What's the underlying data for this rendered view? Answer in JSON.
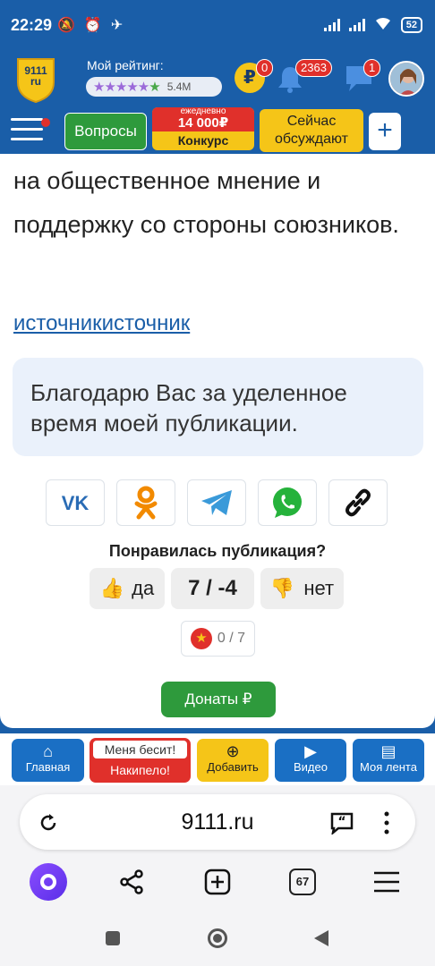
{
  "status_bar": {
    "time": "22:29",
    "battery": "52",
    "left_icons": [
      "muted-bell-icon",
      "alarm-icon",
      "telegram-icon"
    ],
    "right_icons": [
      "signal-icon",
      "signal-icon",
      "wifi-icon",
      "battery-icon"
    ]
  },
  "header": {
    "logo_text_top": "9111",
    "logo_text_bottom": "ru",
    "rating_label": "Мой рейтинг:",
    "stars": "★★★★★",
    "star_last": "★",
    "rating_count": "5.4M",
    "coin_symbol": "₽",
    "coin_badge": "0",
    "notifications_badge": "2363",
    "messages_badge": "1"
  },
  "nav": {
    "questions": "Вопросы",
    "contest_line1": "ежедневно",
    "contest_amount": "14 000₽",
    "contest_label": "Конкурс",
    "discuss": "Сейчас обсуждают",
    "plus": "+"
  },
  "article": {
    "text": "на общественное мнение и поддержку со стороны союзников.",
    "source_link": "источникисточник",
    "thanks": "Благодарю Вас за уделенное время моей публикации."
  },
  "share": [
    "vk-icon",
    "odnoklassniki-icon",
    "telegram-icon",
    "whatsapp-icon",
    "link-icon"
  ],
  "vote": {
    "question": "Понравилась публикация?",
    "yes": "да",
    "score": "7 / -4",
    "no": "нет",
    "rating": "0 / 7"
  },
  "donate": "Донаты ₽",
  "bottom_nav": {
    "home": "Главная",
    "angry_top": "Меня бесит!",
    "angry_bottom": "Накипело!",
    "add": "Добавить",
    "video": "Видео",
    "feed": "Моя лента"
  },
  "browser": {
    "url": "9111.ru",
    "tabs_count": "67"
  },
  "colors": {
    "brand_blue": "#1a5ea8",
    "green": "#2e9a3c",
    "yellow": "#f5c518",
    "red": "#e0302b"
  }
}
